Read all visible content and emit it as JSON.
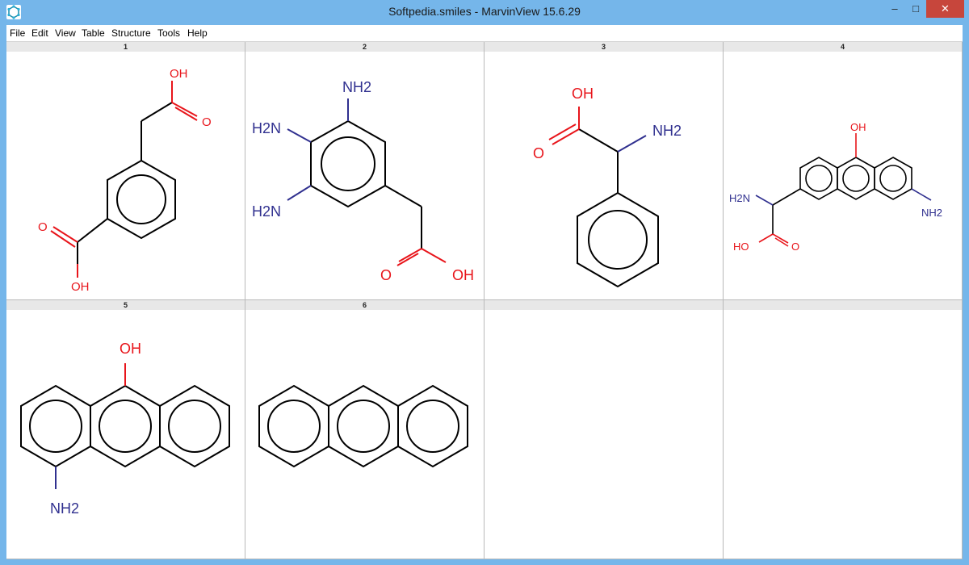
{
  "window": {
    "title": "Softpedia.smiles - MarvinView 15.6.29",
    "controls": {
      "minimize": "–",
      "maximize": "□",
      "close": "✕"
    }
  },
  "menu": [
    "File",
    "Edit",
    "View",
    "Table",
    "Structure",
    "Tools",
    "Help"
  ],
  "cells": [
    {
      "index": "1",
      "labels": {
        "oh": "OH",
        "o": "O",
        "o2": "O",
        "oh2": "OH"
      }
    },
    {
      "index": "2",
      "labels": {
        "nh2a": "NH2",
        "nh2b": "H2N",
        "nh2c": "H2N",
        "o": "O",
        "oh": "OH"
      }
    },
    {
      "index": "3",
      "labels": {
        "oh": "OH",
        "o": "O",
        "nh2": "NH2"
      }
    },
    {
      "index": "4",
      "labels": {
        "oh": "OH",
        "h2n": "H2N",
        "ho": "HO",
        "o": "O",
        "nh2": "NH2"
      }
    },
    {
      "index": "5",
      "labels": {
        "oh": "OH",
        "nh2": "NH2"
      }
    },
    {
      "index": "6",
      "labels": {}
    },
    {
      "index": "",
      "labels": {}
    },
    {
      "index": "",
      "labels": {}
    }
  ],
  "colors": {
    "oxygen": "#e8151b",
    "nitrogen": "#30308f",
    "bond": "#000000",
    "accent": "#75b6ea"
  }
}
